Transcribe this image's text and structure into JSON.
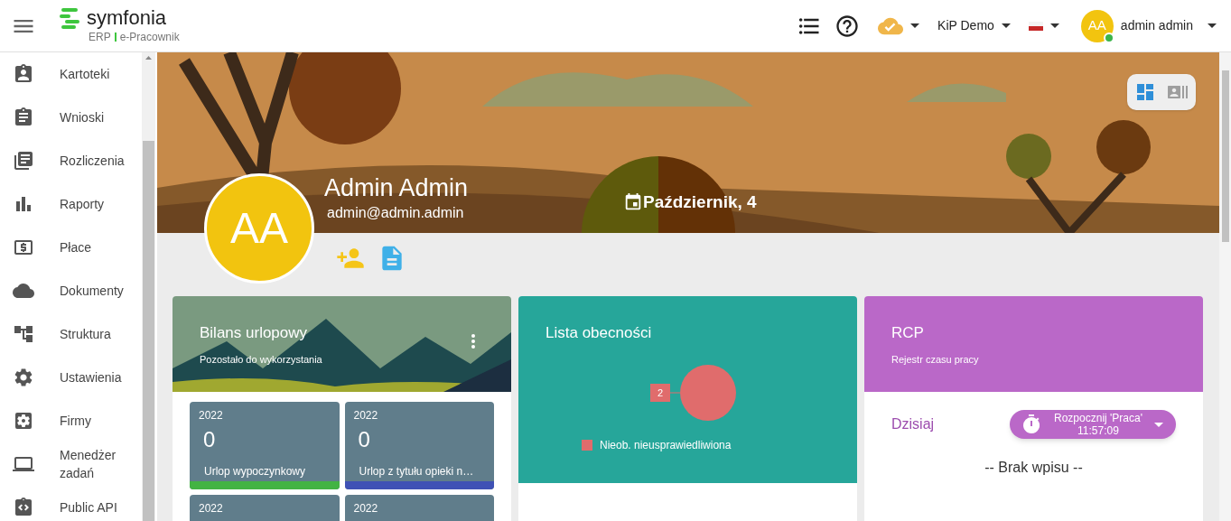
{
  "header": {
    "logo": {
      "name": "symfonia",
      "product": "ERP",
      "module": "e-Pracownik"
    },
    "company": "KiP Demo",
    "user": {
      "initials": "AA",
      "name": "admin admin",
      "online": true
    }
  },
  "sidebar": {
    "items": [
      {
        "label": "Kartoteki"
      },
      {
        "label": "Wnioski"
      },
      {
        "label": "Rozliczenia"
      },
      {
        "label": "Raporty"
      },
      {
        "label": "Płace"
      },
      {
        "label": "Dokumenty"
      },
      {
        "label": "Struktura"
      },
      {
        "label": "Ustawienia"
      },
      {
        "label": "Firmy"
      },
      {
        "label": "Menedżer zadań"
      },
      {
        "label": "Public API"
      }
    ]
  },
  "view_toggle": [
    {
      "selected": true
    },
    {
      "selected": false
    }
  ],
  "profile": {
    "initials": "AA",
    "name": "Admin Admin",
    "email": "admin@admin.admin",
    "date": "Październik, 4"
  },
  "leave_card": {
    "title": "Bilans urlopowy",
    "subtitle": "Pozostało do wykorzystania",
    "tiles": [
      {
        "year": "2022",
        "value": "0",
        "label": "Urlop wypoczynkowy",
        "color": "#43b343"
      },
      {
        "year": "2022",
        "value": "0",
        "label": "Urlop z tytułu opieki n…",
        "color": "#3f51b5"
      },
      {
        "year": "2022"
      },
      {
        "year": "2022"
      }
    ]
  },
  "attendance_card": {
    "title": "Lista obecności",
    "chart_data": {
      "type": "pie",
      "categories": [
        "Nieob. nieusprawiedliwiona"
      ],
      "series": [
        {
          "color": "#e06c6c",
          "values": [
            2
          ]
        }
      ],
      "data_labels": true
    }
  },
  "rcp_card": {
    "title": "RCP",
    "subtitle": "Rejestr czasu pracy",
    "today_label": "Dzisiaj",
    "start_button": {
      "label": "Rozpocznij 'Praca'",
      "time": "11:57:09"
    },
    "empty_text": "-- Brak wpisu --"
  }
}
